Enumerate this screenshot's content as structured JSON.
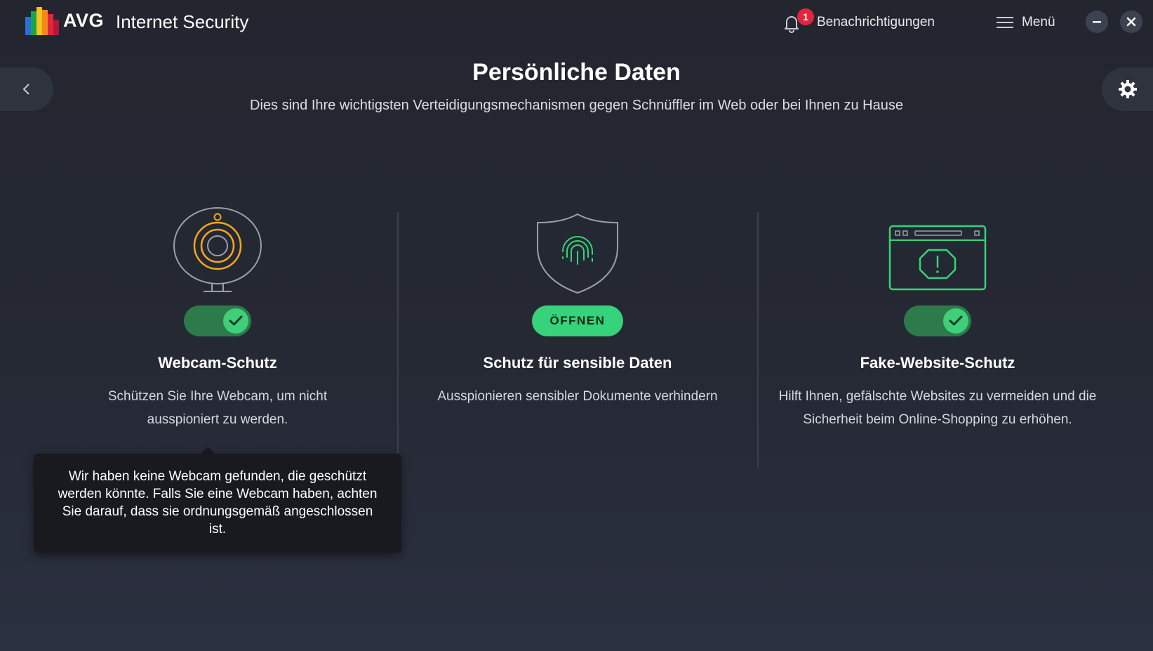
{
  "app": {
    "brand": "AVG",
    "product": "Internet Security"
  },
  "header": {
    "notifications_label": "Benachrichtigungen",
    "notifications_count": "1",
    "menu_label": "Menü"
  },
  "page": {
    "title": "Persönliche Daten",
    "subtitle": "Dies sind Ihre wichtigsten Verteidigungsmechanismen gegen Schnüffler im Web oder bei Ihnen zu Hause"
  },
  "features": [
    {
      "title": "Webcam-Schutz",
      "description": "Schützen Sie Ihre Webcam, um nicht ausspioniert zu werden.",
      "control": "toggle",
      "enabled": true,
      "icon": "webcam-icon"
    },
    {
      "title": "Schutz für sensible Daten",
      "description": "Ausspionieren sensibler Dokumente verhindern",
      "control": "button",
      "button_label": "ÖFFNEN",
      "icon": "fingerprint-shield-icon"
    },
    {
      "title": "Fake-Website-Schutz",
      "description": "Hilft Ihnen, gefälschte Websites zu vermeiden und die Sicherheit beim Online-Shopping zu erhöhen.",
      "control": "toggle",
      "enabled": true,
      "icon": "browser-warning-icon"
    }
  ],
  "tooltip": {
    "text": "Wir haben keine Webcam gefunden, die geschützt werden könnte. Falls Sie eine Webcam haben, achten Sie darauf, dass sie ordnungsgemäß angeschlossen ist."
  },
  "colors": {
    "accent_green": "#36d37a",
    "toggle_track": "#2d7a4b",
    "badge_red": "#e0263b",
    "webcam_orange": "#f5a623",
    "background": "#252934"
  }
}
